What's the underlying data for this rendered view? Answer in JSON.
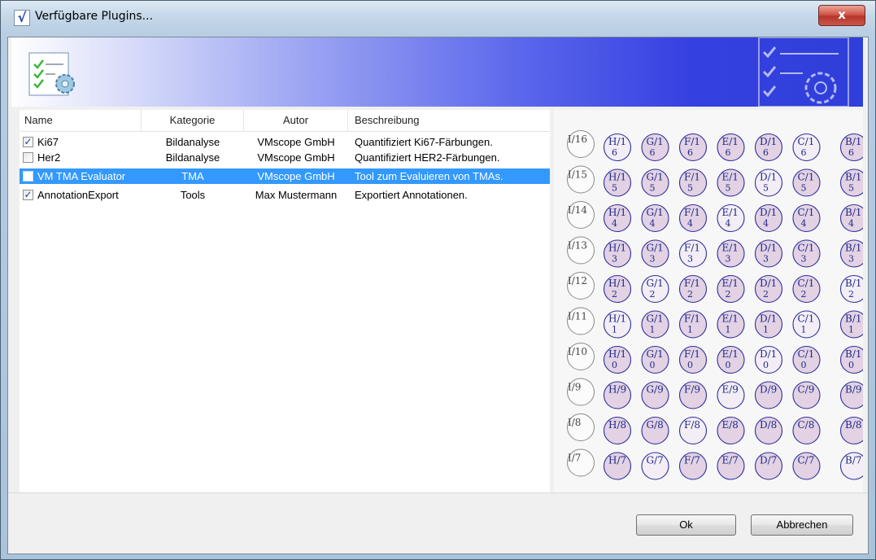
{
  "window": {
    "title": "Verfügbare Plugins...",
    "close_symbol": "x",
    "title_icon": "checkmark-icon"
  },
  "colors": {
    "selection": "#3399ff",
    "banner_start": "#ffffff",
    "banner_end": "#2f3fd9",
    "tma_core": "#c7a3c9",
    "tma_outline": "#2e2f9e"
  },
  "list": {
    "columns": [
      "Name",
      "Kategorie",
      "Autor",
      "Beschreibung"
    ],
    "rows": [
      {
        "checked": true,
        "name": "Ki67",
        "category": "Bildanalyse",
        "author": "VMscope GmbH",
        "description": "Quantifiziert Ki67-Färbungen.",
        "selected": false
      },
      {
        "checked": false,
        "name": "Her2",
        "category": "Bildanalyse",
        "author": "VMscope GmbH",
        "description": "Quantifiziert HER2-Färbungen.",
        "selected": false
      },
      {
        "checked": false,
        "name": "VM TMA Evaluator",
        "category": "TMA",
        "author": "VMscope GmbH",
        "description": "Tool zum Evaluieren von TMAs.",
        "selected": true
      },
      {
        "checked": true,
        "name": "AnnotationExport",
        "category": "Tools",
        "author": "Max Mustermann",
        "description": "Exportiert Annotationen.",
        "selected": false
      }
    ]
  },
  "preview": {
    "row_labels": [
      "I/16",
      "I/15",
      "I/14",
      "I/13",
      "I/12",
      "I/11",
      "I/10",
      "I/9",
      "I/8",
      "I/7"
    ],
    "column_letters": [
      "H",
      "G",
      "F",
      "E",
      "D",
      "C",
      "B"
    ]
  },
  "buttons": {
    "ok": "Ok",
    "cancel": "Abbrechen"
  }
}
